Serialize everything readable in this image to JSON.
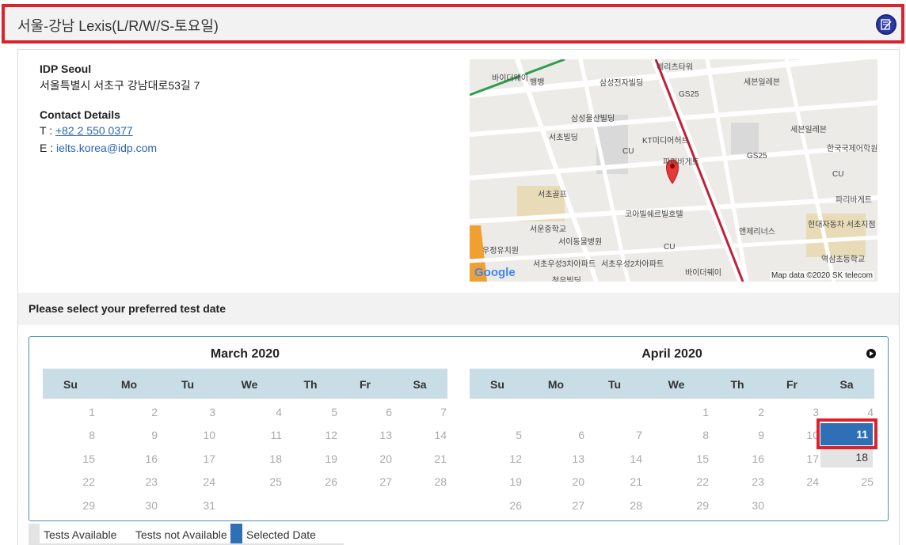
{
  "header": {
    "title": "서울-강남 Lexis(L/R/W/S-토요일)",
    "icon": "edit-note-icon"
  },
  "venue": {
    "name": "IDP Seoul",
    "address": "서울특별시 서초구 강남대로53길 7",
    "contact_heading": "Contact Details",
    "phone_label": "T :",
    "phone": "+82 2 550 0377",
    "email_label": "E :",
    "email": "ielts.korea@idp.com"
  },
  "map": {
    "labels": [
      "메리츠타워",
      "바이더웨이",
      "뱅뱅",
      "삼성전자빌딩",
      "GS25",
      "세븐일레븐",
      "삼성물산빌딩",
      "서초빌딩",
      "KT미디어허브",
      "CU",
      "파리바게트",
      "세븐일레븐",
      "한국국제어학원",
      "GS25",
      "서초골프",
      "CU",
      "파리바게트",
      "코아빌쉐르빌호텔",
      "현대자동차 서초지점",
      "서운중학교",
      "서이동물병원",
      "앤제리너스",
      "우정유치원",
      "CU",
      "역삼초등학교",
      "서초우성3차아파트",
      "서초우성2차아파트",
      "바이더웨이",
      "청우빌딩"
    ],
    "logo": "Google",
    "credit": "Map data ©2020 SK telecom"
  },
  "prompt": "Please select your preferred test date",
  "calendar": {
    "weekdays": [
      "Su",
      "Mo",
      "Tu",
      "We",
      "Th",
      "Fr",
      "Sa"
    ],
    "months": [
      {
        "title": "March 2020",
        "weeks": [
          [
            "1",
            "2",
            "3",
            "4",
            "5",
            "6",
            "7"
          ],
          [
            "8",
            "9",
            "10",
            "11",
            "12",
            "13",
            "14"
          ],
          [
            "15",
            "16",
            "17",
            "18",
            "19",
            "20",
            "21"
          ],
          [
            "22",
            "23",
            "24",
            "25",
            "26",
            "27",
            "28"
          ],
          [
            "29",
            "30",
            "31",
            "",
            "",
            "",
            ""
          ]
        ]
      },
      {
        "title": "April 2020",
        "weeks": [
          [
            "",
            "",
            "",
            "1",
            "2",
            "3",
            "4"
          ],
          [
            "5",
            "6",
            "7",
            "8",
            "9",
            "10",
            "11"
          ],
          [
            "12",
            "13",
            "14",
            "15",
            "16",
            "17",
            "18"
          ],
          [
            "19",
            "20",
            "21",
            "22",
            "23",
            "24",
            "25"
          ],
          [
            "26",
            "27",
            "28",
            "29",
            "30",
            "",
            ""
          ]
        ]
      }
    ],
    "selected": "11",
    "available": [
      "18"
    ],
    "next_icon": "next-month-icon"
  },
  "legend": {
    "available": "Tests Available",
    "not_available": "Tests not Available",
    "selected": "Selected Date"
  },
  "colors": {
    "highlight_frame": "#d9232e",
    "selected": "#2f6fb6",
    "available": "#e4e4e4",
    "weekday_bar": "#c9dde6",
    "link": "#2a64b5"
  }
}
